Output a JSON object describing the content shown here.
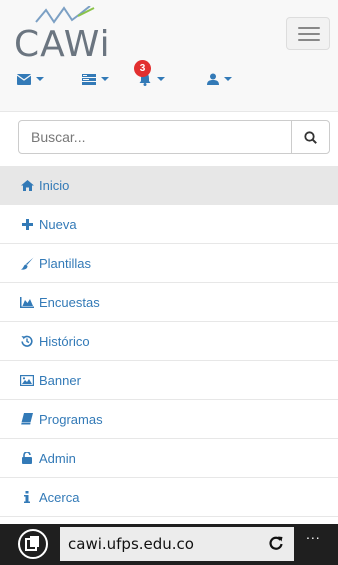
{
  "header": {
    "logo_text": "CAWi",
    "notifications_count": "3"
  },
  "navicons": [
    {
      "name": "messages",
      "icon": "envelope-icon"
    },
    {
      "name": "tasks",
      "icon": "tasks-icon"
    },
    {
      "name": "alerts",
      "icon": "bell-icon"
    },
    {
      "name": "user",
      "icon": "user-icon"
    }
  ],
  "search": {
    "placeholder": "Buscar..."
  },
  "menu": {
    "items": [
      {
        "label": "Inicio",
        "icon": "home-icon"
      },
      {
        "label": "Nueva",
        "icon": "plus-icon"
      },
      {
        "label": "Plantillas",
        "icon": "brush-icon"
      },
      {
        "label": "Encuestas",
        "icon": "area-chart-icon"
      },
      {
        "label": "Histórico",
        "icon": "history-icon"
      },
      {
        "label": "Banner",
        "icon": "picture-icon"
      },
      {
        "label": "Programas",
        "icon": "book-icon"
      },
      {
        "label": "Admin",
        "icon": "unlock-icon"
      },
      {
        "label": "Acerca",
        "icon": "info-icon"
      }
    ]
  },
  "browser": {
    "url": "cawi.ufps.edu.co",
    "more": "..."
  },
  "colors": {
    "link": "#337ab7",
    "active_item_bg": "#e7e7e7",
    "badge": "#e22f2f",
    "browser_bar": "#1f1f1f"
  }
}
